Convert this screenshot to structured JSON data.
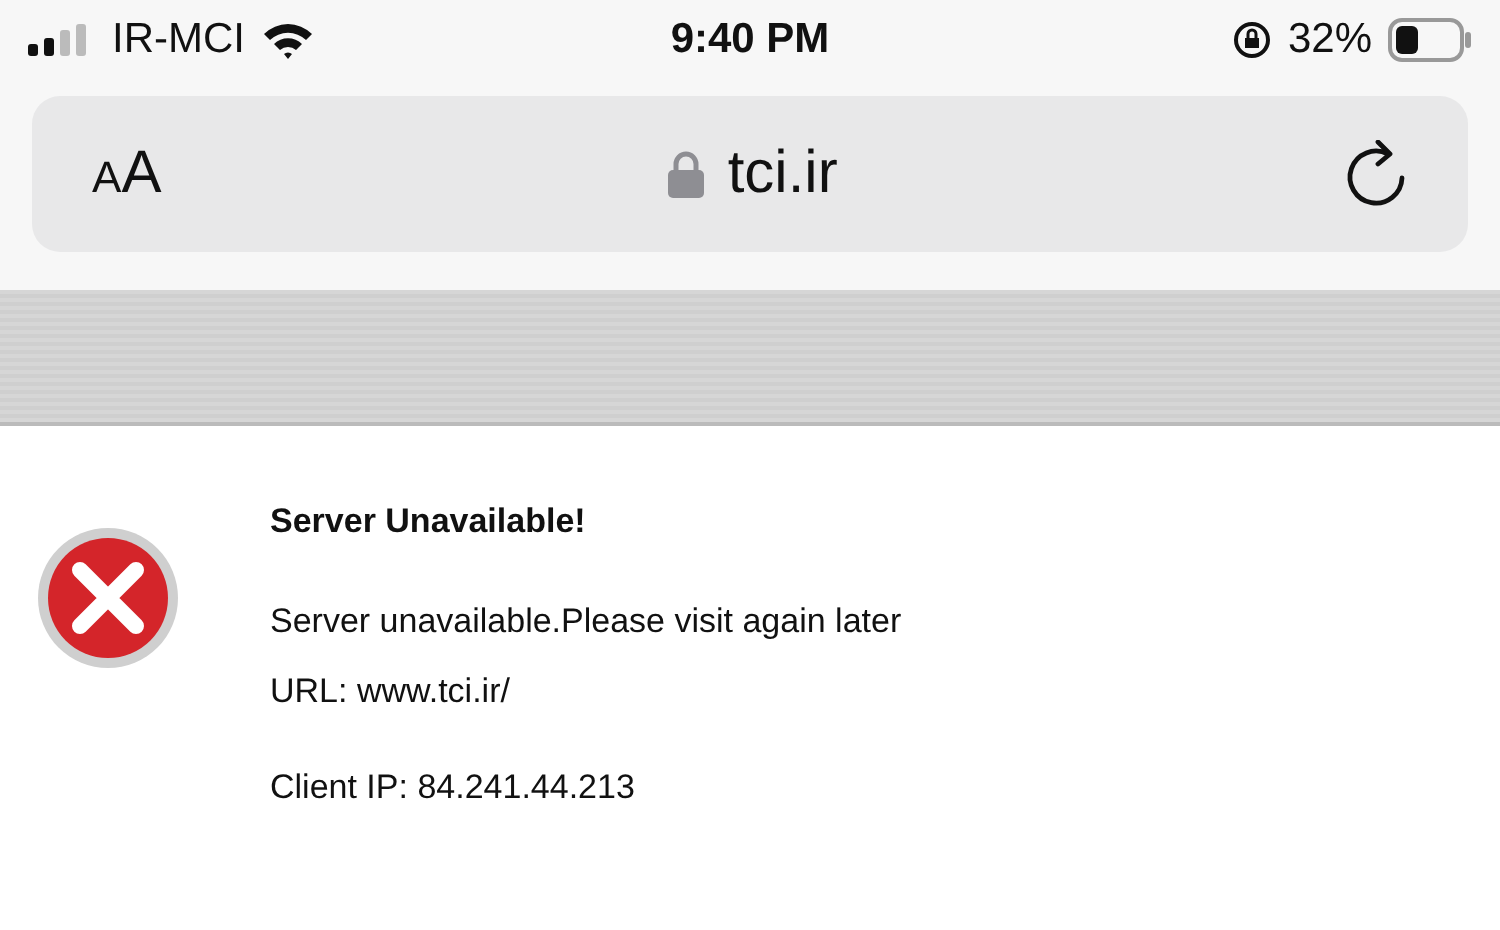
{
  "status_bar": {
    "carrier": "IR-MCI",
    "time": "9:40 PM",
    "battery": "32%"
  },
  "address_bar": {
    "text_size_label": "AA",
    "url": "tci.ir"
  },
  "error_page": {
    "title": "Server Unavailable!",
    "message": "Server unavailable.Please visit again later",
    "url_line": "URL: www.tci.ir/",
    "client_ip": "Client IP: 84.241.44.213"
  }
}
